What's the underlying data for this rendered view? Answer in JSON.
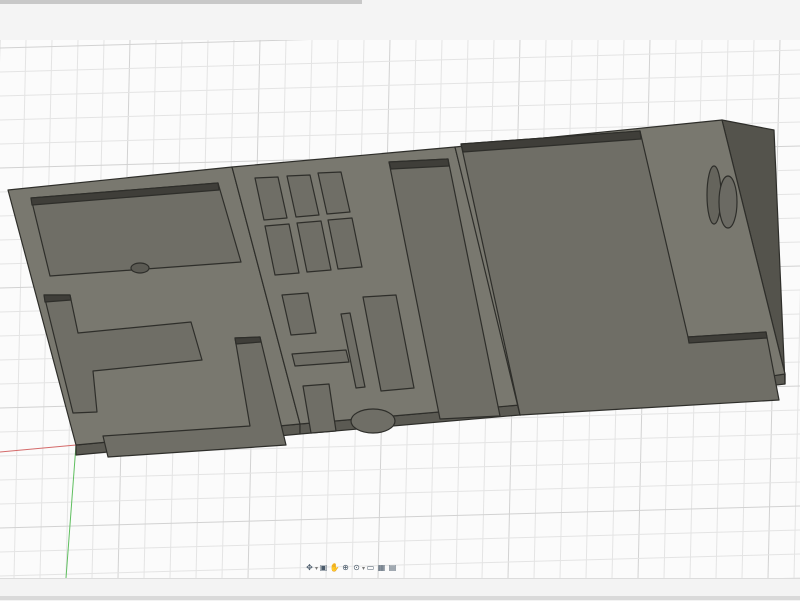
{
  "app": {
    "colors": {
      "grid_minor": "#e4e4e4",
      "grid_major": "#d2d2d2",
      "model_top": "#79786f",
      "model_side": "#5b5a53",
      "model_edge": "#2e2e2a",
      "axis_green": "#5fbf5f",
      "axis_red": "#d46a6a"
    }
  },
  "navbar": {
    "tools": [
      {
        "icon": "orbit-icon",
        "glyph": "✥"
      },
      {
        "icon": "look-at-icon",
        "glyph": "▣"
      },
      {
        "icon": "pan-icon",
        "glyph": "✋"
      },
      {
        "icon": "zoom-icon",
        "glyph": "⊕"
      },
      {
        "icon": "fit-icon",
        "glyph": "⊙"
      },
      {
        "icon": "display-settings-icon",
        "glyph": "▭"
      },
      {
        "icon": "grid-settings-icon",
        "glyph": "▦"
      },
      {
        "icon": "viewports-icon",
        "glyph": "▤"
      }
    ]
  }
}
